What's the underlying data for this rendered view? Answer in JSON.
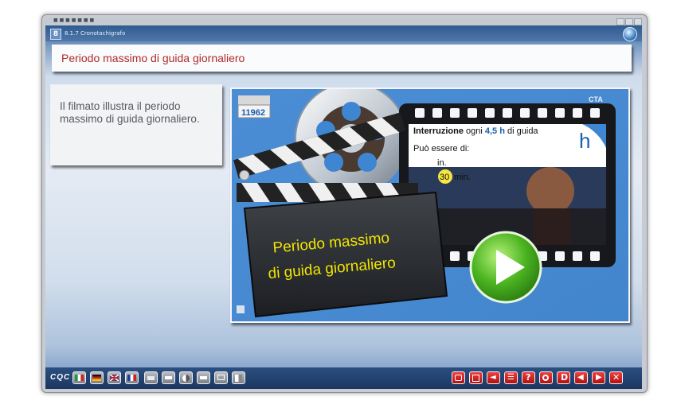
{
  "window": {
    "title": "■ ■ ■ ■ ■ ■ ■"
  },
  "app": {
    "badge": "8",
    "module": "8.1.7 Cronotachigrafo"
  },
  "page": {
    "title": "Periodo massimo di guida giornaliero"
  },
  "description": {
    "text": "Il filmato illustra il periodo massimo di guida giornaliero."
  },
  "video": {
    "counter": "11962",
    "clapboard_line1": "Periodo massimo",
    "clapboard_line2": "di guida giornaliero",
    "info_prefix": "Interruzione",
    "info_middle": "ogni",
    "info_hours": "4,5 h",
    "info_suffix": "di guida",
    "split_label": "Può essere di:",
    "split_line1": "in.",
    "split_num": "30",
    "split_line2": "min.",
    "letter_h": "h",
    "brand": "CTA",
    "colors": {
      "accent": "#3f86d2",
      "play": "#4bb320",
      "title": "#b02a2a",
      "clap_text": "#f2e600"
    }
  },
  "toolbar": {
    "logo": "CQC",
    "left_buttons": [
      {
        "name": "flag-it-button",
        "icon": "flag-italy-icon"
      },
      {
        "name": "flag-de-button",
        "icon": "flag-germany-icon"
      },
      {
        "name": "flag-uk-button",
        "icon": "flag-uk-icon"
      },
      {
        "name": "flag-fr-button",
        "icon": "flag-france-icon"
      },
      {
        "name": "tool-button-1",
        "icon": "keyboard-icon"
      },
      {
        "name": "tool-button-2",
        "icon": "bar-icon"
      },
      {
        "name": "tool-button-3",
        "icon": "contrast-icon"
      },
      {
        "name": "tool-button-4",
        "icon": "bar-icon"
      },
      {
        "name": "tool-button-5",
        "icon": "display-icon"
      },
      {
        "name": "tool-button-6",
        "icon": "half-icon"
      }
    ],
    "right_buttons": [
      {
        "name": "network-button",
        "icon": "network-icon"
      },
      {
        "name": "list-button",
        "icon": "list-icon"
      },
      {
        "name": "volume-button",
        "icon": "speaker-icon"
      },
      {
        "name": "index-button",
        "icon": "index-icon"
      },
      {
        "name": "help-button",
        "icon": "question-icon",
        "label": "?"
      },
      {
        "name": "record-button",
        "icon": "record-icon"
      },
      {
        "name": "d-button",
        "icon": "d-icon",
        "label": "D"
      },
      {
        "name": "prev-button",
        "icon": "left-arrow-icon"
      },
      {
        "name": "next-button",
        "icon": "right-arrow-icon"
      },
      {
        "name": "close-button",
        "icon": "close-icon",
        "label": "✕"
      }
    ]
  }
}
